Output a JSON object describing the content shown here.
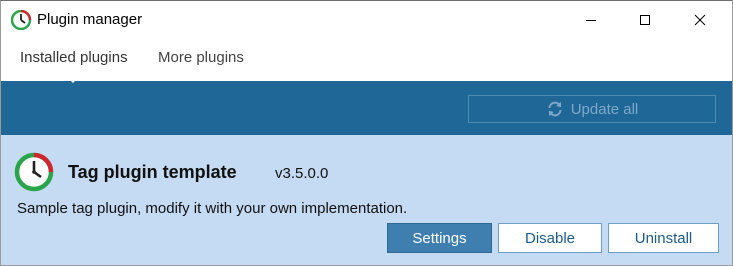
{
  "window": {
    "title": "Plugin manager",
    "app_icon": "clock-icon"
  },
  "tabs": [
    {
      "label": "Installed plugins",
      "selected": true
    },
    {
      "label": "More plugins",
      "selected": false
    }
  ],
  "toolbar": {
    "update_all_label": "Update all",
    "update_all_icon": "refresh-icon",
    "update_all_enabled": false
  },
  "plugins": [
    {
      "name": "Tag plugin template",
      "version": "v3.5.0.0",
      "description": "Sample tag plugin, modify it with your own implementation.",
      "icon": "clock-icon",
      "actions": {
        "settings_label": "Settings",
        "disable_label": "Disable",
        "uninstall_label": "Uninstall"
      }
    }
  ],
  "colors": {
    "toolbar_bg": "#1e6797",
    "row_selected_bg": "#c5daf3",
    "primary_button": "#3f7fb0",
    "icon_ring": "#2aa44a",
    "icon_hand": "#d1262c"
  }
}
